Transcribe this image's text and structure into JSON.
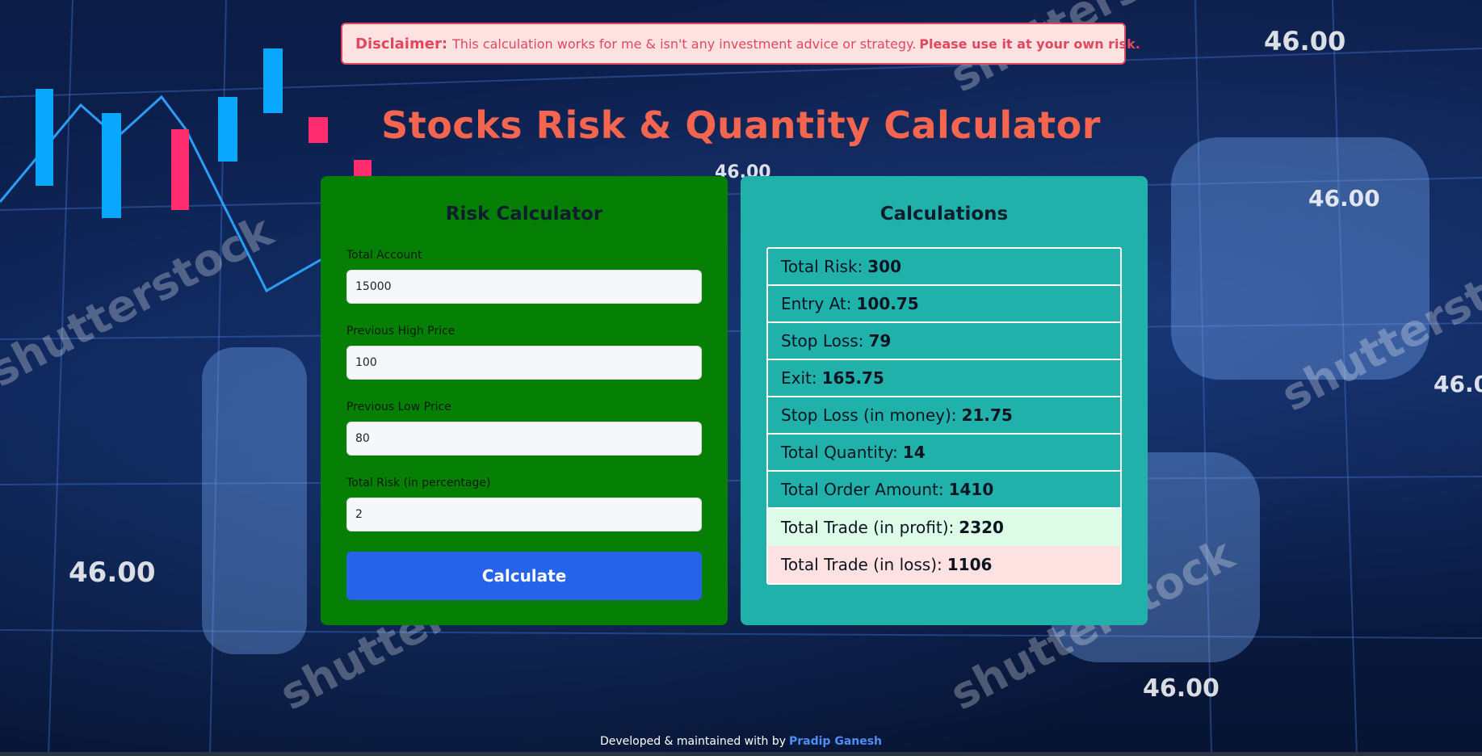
{
  "disclaimer": {
    "label": "Disclaimer:",
    "text": "This calculation works for me & isn't any investment advice or strategy.",
    "emphasis": "Please use it at your own risk."
  },
  "title": "Stocks Risk & Quantity Calculator",
  "risk_calculator": {
    "title": "Risk Calculator",
    "fields": [
      {
        "label": "Total Account",
        "value": "15000"
      },
      {
        "label": "Previous High Price",
        "value": "100"
      },
      {
        "label": "Previous Low Price",
        "value": "80"
      },
      {
        "label": "Total Risk (in percentage)",
        "value": "2"
      }
    ],
    "button_label": "Calculate"
  },
  "calculations": {
    "title": "Calculations",
    "rows": [
      {
        "label": "Total Risk:",
        "value": "300"
      },
      {
        "label": "Entry At:",
        "value": "100.75"
      },
      {
        "label": "Stop Loss:",
        "value": "79"
      },
      {
        "label": "Exit:",
        "value": "165.75"
      },
      {
        "label": "Stop Loss (in money):",
        "value": "21.75"
      },
      {
        "label": "Total Quantity:",
        "value": "14"
      },
      {
        "label": "Total Order Amount:",
        "value": "1410"
      },
      {
        "label": "Total Trade (in profit):",
        "value": "2320"
      },
      {
        "label": "Total Trade (in loss):",
        "value": "1106"
      }
    ]
  },
  "footer": {
    "text": "Developed & maintained with by",
    "author": "Pradip Ganesh"
  },
  "colors": {
    "title": "#f46550",
    "left_panel": "#058005",
    "right_panel": "#20b2aa",
    "button": "#2563eb",
    "profit_row": "#dcfce7",
    "loss_row": "#fee2e2"
  }
}
